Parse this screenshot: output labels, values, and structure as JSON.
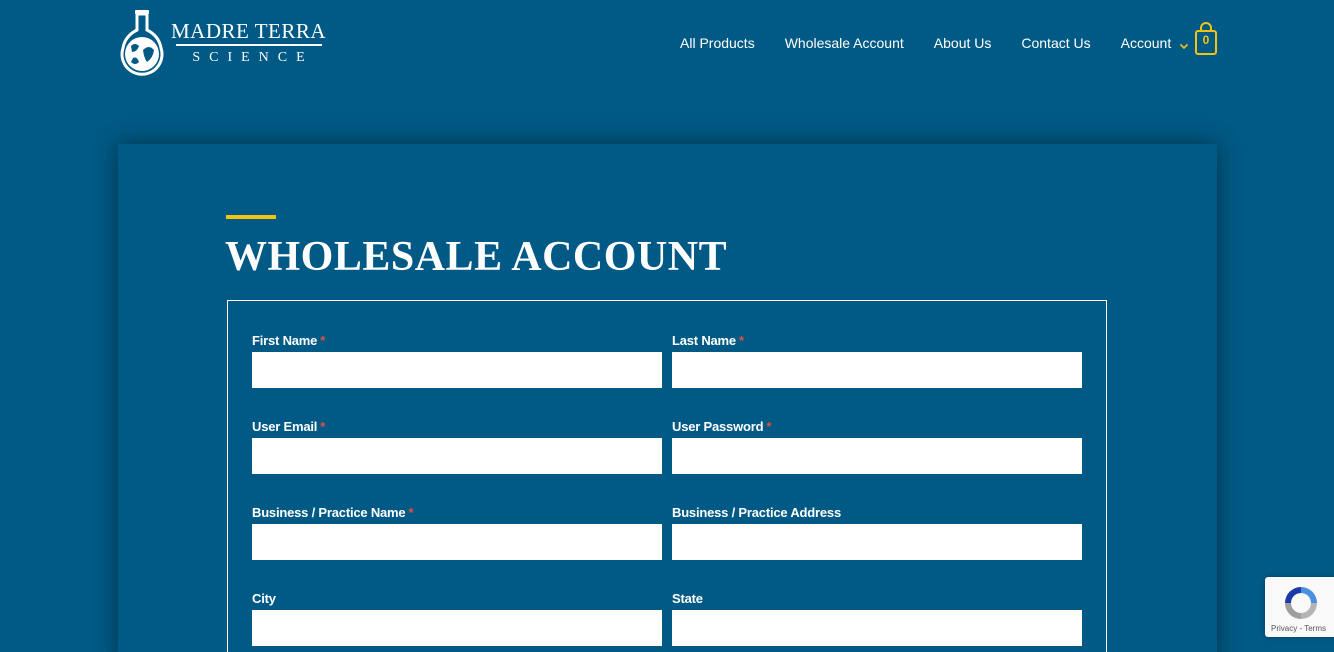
{
  "brand": {
    "name_line1": "MADRE TERRA",
    "name_line2": "SCIENCE",
    "logo_icon": "flask-globe-icon"
  },
  "nav": {
    "items": [
      {
        "label": "All Products"
      },
      {
        "label": "Wholesale Account"
      },
      {
        "label": "About Us"
      },
      {
        "label": "Contact Us"
      },
      {
        "label": "Account"
      }
    ],
    "cart": {
      "count": "0",
      "icon": "shopping-bag-icon"
    }
  },
  "page": {
    "title": "WHOLESALE ACCOUNT"
  },
  "form": {
    "required_marker": "*",
    "fields": [
      {
        "label": "First Name",
        "required": true,
        "value": ""
      },
      {
        "label": "Last Name",
        "required": true,
        "value": ""
      },
      {
        "label": "User Email",
        "required": true,
        "value": ""
      },
      {
        "label": "User Password",
        "required": true,
        "value": ""
      },
      {
        "label": "Business / Practice Name",
        "required": true,
        "value": ""
      },
      {
        "label": "Business / Practice Address",
        "required": false,
        "value": ""
      },
      {
        "label": "City",
        "required": false,
        "value": ""
      },
      {
        "label": "State",
        "required": false,
        "value": ""
      }
    ]
  },
  "recaptcha": {
    "privacy": "Privacy",
    "separator": " - ",
    "terms": "Terms",
    "icon": "recaptcha-icon"
  },
  "colors": {
    "background": "#015a85",
    "accent": "#f1c40f",
    "required": "#e0503c",
    "text": "#ffffff"
  }
}
